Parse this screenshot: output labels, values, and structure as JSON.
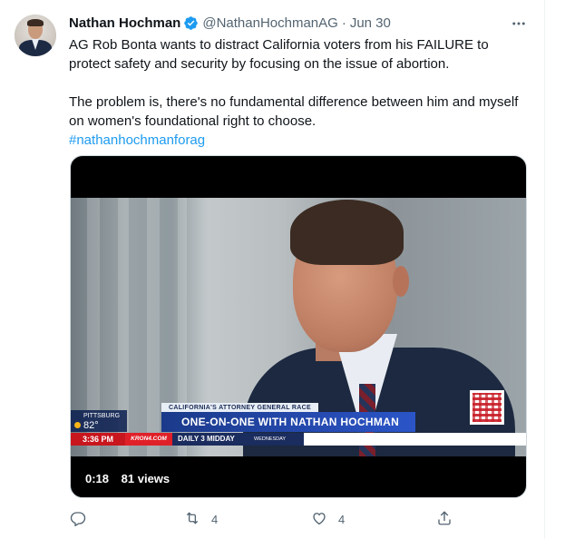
{
  "tweet": {
    "author_name": "Nathan Hochman",
    "handle": "@NathanHochmanAG",
    "separator": "·",
    "date": "Jun 30",
    "lines": [
      "AG Rob Bonta wants to distract California voters from his FAILURE to",
      "protect safety and security by focusing on the issue of abortion.",
      "The problem is, there's no fundamental difference between him and myself",
      "on women's foundational right to choose."
    ],
    "hashtag": "#nathanhochmanforag"
  },
  "video": {
    "overlay_topic": "CALIFORNIA'S ATTORNEY GENERAL RACE",
    "overlay_headline": "ONE-ON-ONE WITH NATHAN HOCHMAN",
    "weather_city": "PITTSBURG",
    "weather_temp": "82°",
    "clock": "3:36 PM",
    "site": "KRON4.COM",
    "show": "DAILY 3 MIDDAY",
    "weekday": "WEDNESDAY",
    "duration": "0:18",
    "views": "81 views"
  },
  "actions": {
    "retweet_count": "4",
    "like_count": "4"
  },
  "colors": {
    "link": "#1d9bf0",
    "verified": "#1d9bf0",
    "muted": "#536471"
  },
  "icons": {
    "verified": "verified-badge-icon",
    "more": "more-icon",
    "reply": "reply-icon",
    "retweet": "retweet-icon",
    "like": "heart-icon",
    "share": "share-icon"
  }
}
